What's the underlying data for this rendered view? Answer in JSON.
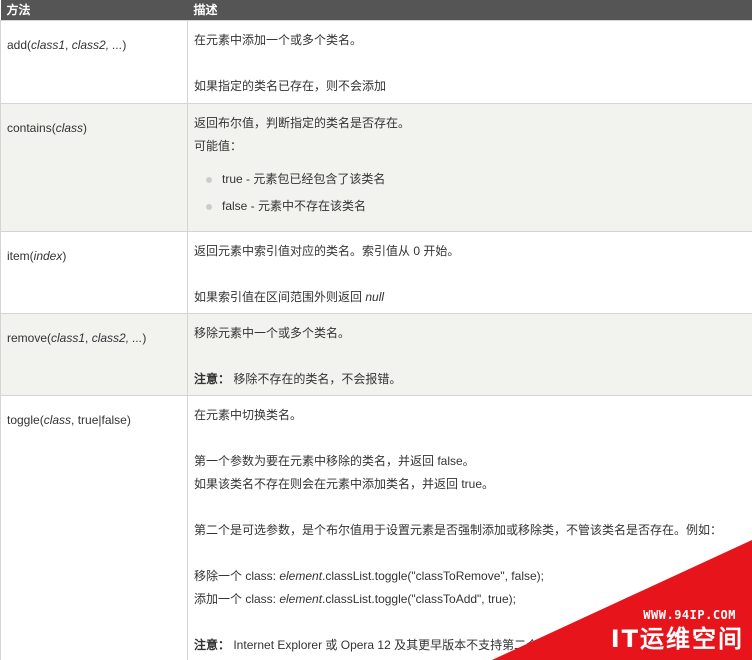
{
  "table": {
    "headers": {
      "method": "方法",
      "description": "描述"
    },
    "rows": [
      {
        "method": {
          "name": "add(",
          "args": [
            {
              "text": "class1",
              "italic": true
            },
            {
              "text": ", ",
              "italic": false
            },
            {
              "text": "class2",
              "italic": true
            },
            {
              "text": ", ...",
              "italic": true
            },
            {
              "text": ")",
              "italic": false
            }
          ]
        },
        "description": {
          "line1": "在元素中添加一个或多个类名。",
          "line2": "如果指定的类名已存在，则不会添加"
        }
      },
      {
        "method": {
          "name": "contains(",
          "arg": "class",
          "close": ")"
        },
        "description": {
          "line1": "返回布尔值，判断指定的类名是否存在。",
          "line2": "可能值：",
          "bullets": [
            "true - 元素包已经包含了该类名",
            "false - 元素中不存在该类名"
          ]
        }
      },
      {
        "method": {
          "name": "item(",
          "arg": "index",
          "close": ")"
        },
        "description": {
          "line1": "返回元素中索引值对应的类名。索引值从 0 开始。",
          "line2_prefix": "如果索引值在区间范围外则返回 ",
          "line2_null": "null"
        }
      },
      {
        "method": {
          "name": "remove(",
          "args_text_1": "class1",
          "sep": ", ",
          "args_text_2": "class2",
          "rest": ", ...",
          "close": ")"
        },
        "description": {
          "line1": "移除元素中一个或多个类名。",
          "note_label": "注意：",
          "note_text": " 移除不存在的类名，不会报错。"
        }
      },
      {
        "method": {
          "name": "toggle(",
          "arg_italic": "class",
          "arg_rest": ", true|false)"
        },
        "description": {
          "line1": "在元素中切换类名。",
          "line2": "第一个参数为要在元素中移除的类名，并返回 false。",
          "line3": "如果该类名不存在则会在元素中添加类名，并返回 true。",
          "line4": "第二个是可选参数，是个布尔值用于设置元素是否强制添加或移除类，不管该类名是否存在。例如：",
          "ex1_prefix": "移除一个 class: ",
          "ex1_obj": "element",
          "ex1_code": ".classList.toggle(\"classToRemove\", false);",
          "ex2_prefix": "添加一个 class: ",
          "ex2_obj": "element",
          "ex2_code": ".classList.toggle(\"classToAdd\", true);",
          "note_label": "注意：",
          "note_text": " Internet Explorer 或 Opera 12 及其更早版本不支持第二个参数。"
        }
      }
    ]
  },
  "watermark": {
    "url": "WWW.94IP.COM",
    "name": "IT运维空间",
    "color": "#e8141b"
  }
}
